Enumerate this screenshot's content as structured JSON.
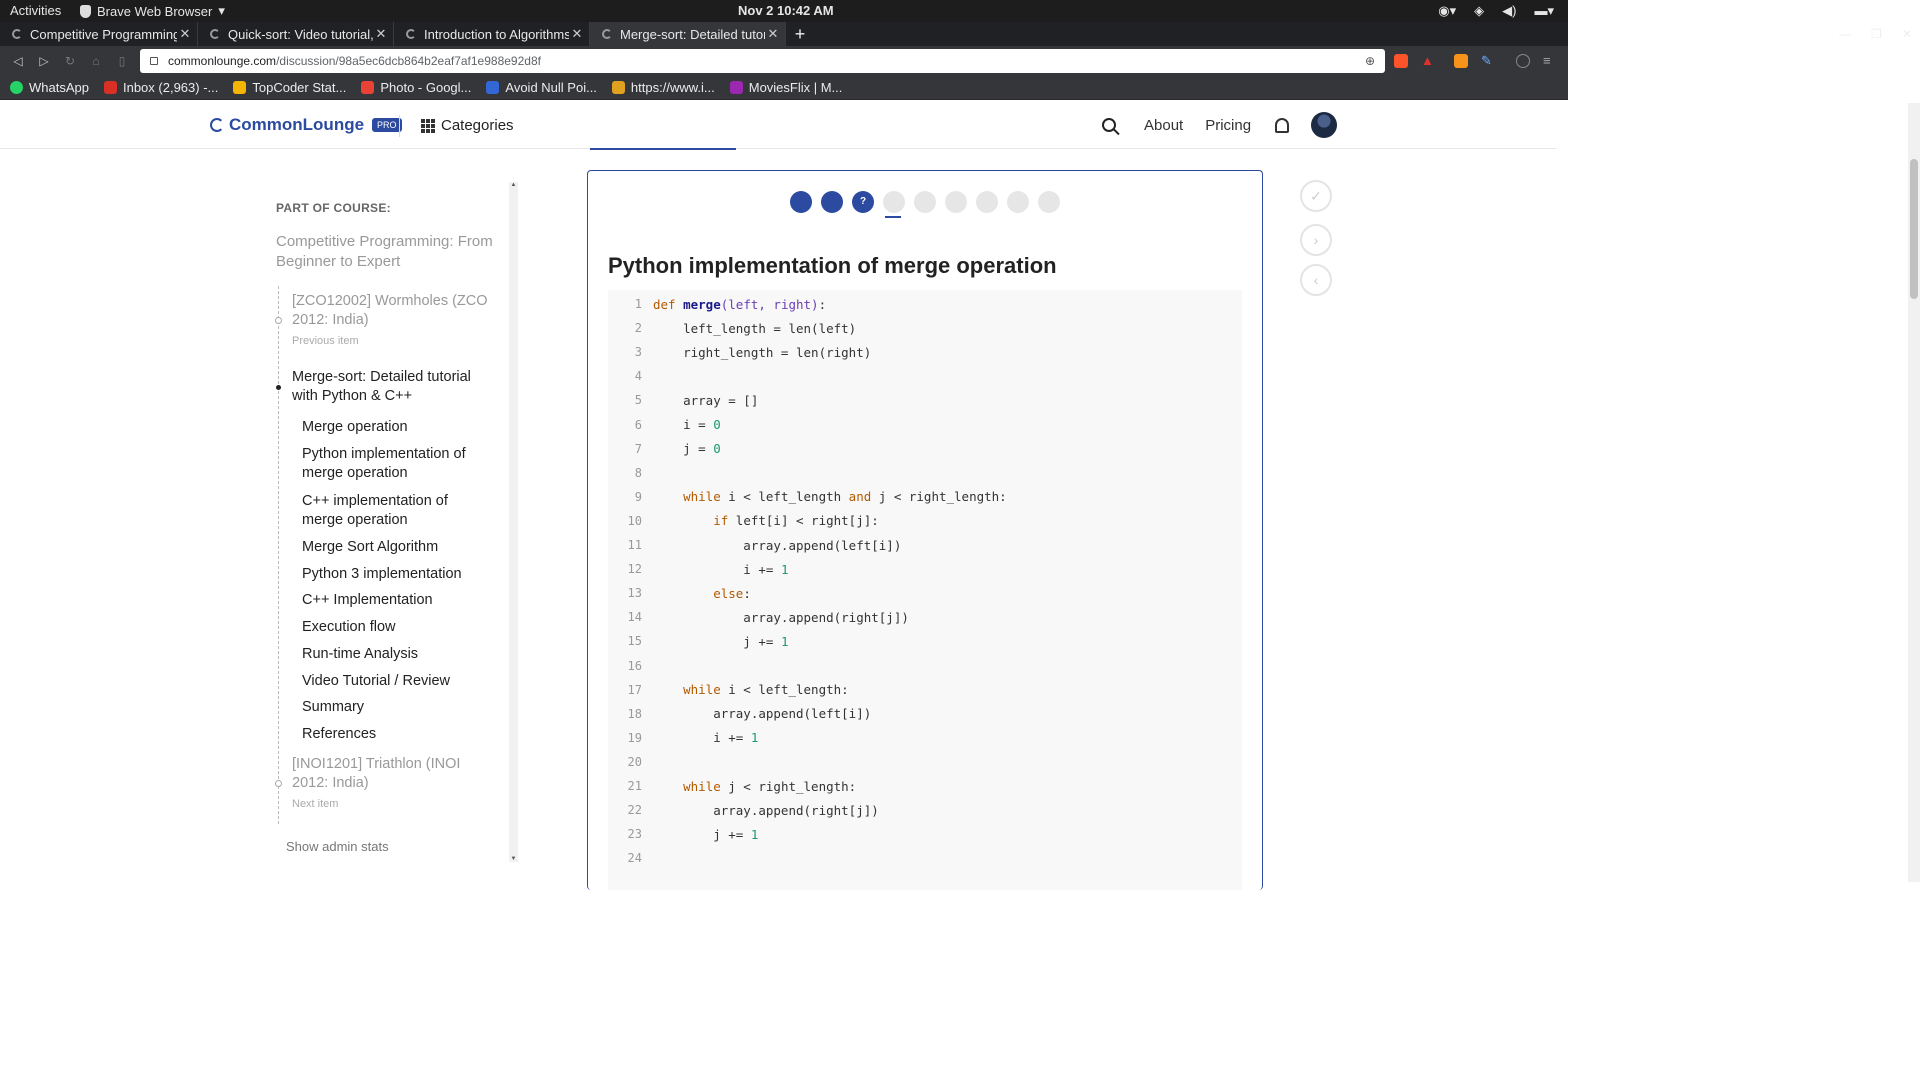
{
  "system": {
    "activities": "Activities",
    "app_name": "Brave Web Browser",
    "clock": "Nov 2  10:42 AM"
  },
  "tabs": [
    {
      "title": "Competitive Programming",
      "active": false
    },
    {
      "title": "Quick-sort: Video tutorial,",
      "active": false
    },
    {
      "title": "Introduction to Algorithms",
      "active": false
    },
    {
      "title": "Merge-sort: Detailed tutor",
      "active": true
    }
  ],
  "address": {
    "host": "commonlounge.com",
    "path": "/discussion/98a5ec6dcb864b2eaf7af1e988e92d8f"
  },
  "bookmarks": [
    {
      "label": "WhatsApp",
      "color": "#25d366"
    },
    {
      "label": "Inbox (2,963) -...",
      "color": "#d93025"
    },
    {
      "label": "TopCoder Stat...",
      "color": "#f4b400"
    },
    {
      "label": "Photo - Googl...",
      "color": "#ea4335"
    },
    {
      "label": "Avoid Null Poi...",
      "color": "#3367d6"
    },
    {
      "label": "https://www.i...",
      "color": "#e0a020"
    },
    {
      "label": "MoviesFlix | M...",
      "color": "#9c27b0"
    }
  ],
  "site": {
    "brand": "CommonLounge",
    "badge": "PRO",
    "categories": "Categories",
    "nav_about": "About",
    "nav_pricing": "Pricing",
    "accent": "#2b4aa0"
  },
  "sidebar": {
    "label": "PART OF COURSE:",
    "course": "Competitive Programming: From Beginner to Expert",
    "previous": {
      "title": "[ZCO12002] Wormholes (ZCO 2012: India)",
      "sub": "Previous item"
    },
    "current": "Merge-sort: Detailed tutorial with Python & C++",
    "toc": [
      "Merge operation",
      "Python implementation of merge operation",
      "C++ implementation of merge operation",
      "Merge Sort Algorithm",
      "Python 3 implementation",
      "C++ Implementation",
      "Execution flow",
      "Run-time Analysis",
      "Video Tutorial / Review",
      "Summary",
      "References"
    ],
    "next": {
      "title": "[INOI1201] Triathlon (INOI 2012: India)",
      "sub": "Next item"
    },
    "admin": "Show admin stats"
  },
  "progress": {
    "total": 9,
    "done": 2,
    "current_label": "?"
  },
  "article": {
    "title": "Python implementation of merge operation"
  },
  "code_numbers": [
    "1",
    "2",
    "3",
    "4",
    "5",
    "6",
    "7",
    "8",
    "9",
    "10",
    "11",
    "12",
    "13",
    "14",
    "15",
    "16",
    "17",
    "18",
    "19",
    "20",
    "21",
    "22",
    "23",
    "24"
  ],
  "code_lines": [
    [
      [
        "kw",
        "def "
      ],
      [
        "fn",
        "merge"
      ],
      [
        "par",
        "(left, right)"
      ],
      [
        "",
        ":"
      ]
    ],
    [
      [
        "",
        "    left_length = len(left)"
      ]
    ],
    [
      [
        "",
        "    right_length = len(right)"
      ]
    ],
    [],
    [
      [
        "",
        "    array = []"
      ]
    ],
    [
      [
        "",
        "    i = "
      ],
      [
        "num",
        "0"
      ]
    ],
    [
      [
        "",
        "    j = "
      ],
      [
        "num",
        "0"
      ]
    ],
    [],
    [
      [
        "kw",
        "    while"
      ],
      [
        "",
        " i < left_length "
      ],
      [
        "kw",
        "and"
      ],
      [
        "",
        " j < right_length:"
      ]
    ],
    [
      [
        "kw",
        "        if"
      ],
      [
        "",
        " left[i] < right[j]:"
      ]
    ],
    [
      [
        "",
        "            array.append(left[i])"
      ]
    ],
    [
      [
        "",
        "            i += "
      ],
      [
        "num",
        "1"
      ]
    ],
    [
      [
        "kw",
        "        else"
      ],
      [
        "",
        ":"
      ]
    ],
    [
      [
        "",
        "            array.append(right[j])"
      ]
    ],
    [
      [
        "",
        "            j += "
      ],
      [
        "num",
        "1"
      ]
    ],
    [],
    [
      [
        "kw",
        "    while"
      ],
      [
        "",
        " i < left_length:"
      ]
    ],
    [
      [
        "",
        "        array.append(left[i])"
      ]
    ],
    [
      [
        "",
        "        i += "
      ],
      [
        "num",
        "1"
      ]
    ],
    [],
    [
      [
        "kw",
        "    while"
      ],
      [
        "",
        " j < right_length:"
      ]
    ],
    [
      [
        "",
        "        array.append(right[j])"
      ]
    ],
    [
      [
        "",
        "        j += "
      ],
      [
        "num",
        "1"
      ]
    ],
    []
  ]
}
